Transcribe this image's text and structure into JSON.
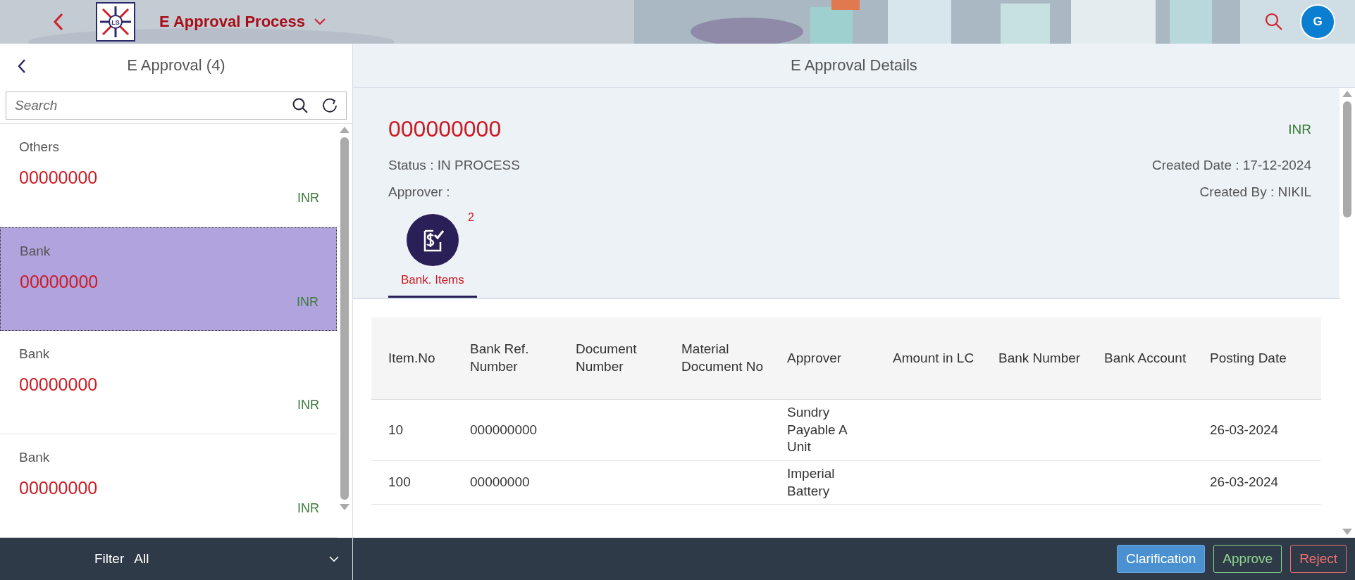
{
  "header": {
    "logo_text": "LS",
    "title": "E Approval Process",
    "avatar": "G"
  },
  "list_panel": {
    "title": "E Approval (4)",
    "search": {
      "placeholder": "Search"
    },
    "items": [
      {
        "category": "Others",
        "amount": "00000000",
        "currency": "INR",
        "selected": false
      },
      {
        "category": "Bank",
        "amount": "00000000",
        "currency": "INR",
        "selected": true
      },
      {
        "category": "Bank",
        "amount": "00000000",
        "currency": "INR",
        "selected": false
      },
      {
        "category": "Bank",
        "amount": "00000000",
        "currency": "INR",
        "selected": false
      }
    ],
    "filter": {
      "label": "Filter",
      "value": "All"
    }
  },
  "detail": {
    "title": "E Approval Details",
    "number": "000000000",
    "currency": "INR",
    "status": "Status : IN PROCESS",
    "approver": "Approver :",
    "created_date": "Created Date : 17-12-2024",
    "created_by": "Created By : NIKIL",
    "tabs": [
      {
        "label": "Bank. Items",
        "count": "2",
        "selected": true
      }
    ],
    "table": {
      "columns": [
        "Item.No",
        "Bank Ref. Number",
        "Document Number",
        "Material Document No",
        "Approver",
        "Amount in LC",
        "Bank Number",
        "Bank Account",
        "Posting Date"
      ],
      "rows": [
        [
          "10",
          "000000000",
          "",
          "",
          "Sundry Payable A Unit",
          "",
          "",
          "",
          "26-03-2024"
        ],
        [
          "100",
          "00000000",
          "",
          "",
          "Imperial Battery",
          "",
          "",
          "",
          "26-03-2024"
        ]
      ]
    }
  },
  "actions": [
    {
      "label": "Clarification",
      "kind": "primary"
    },
    {
      "label": "Approve",
      "kind": "accept"
    },
    {
      "label": "Reject",
      "kind": "reject"
    }
  ]
}
